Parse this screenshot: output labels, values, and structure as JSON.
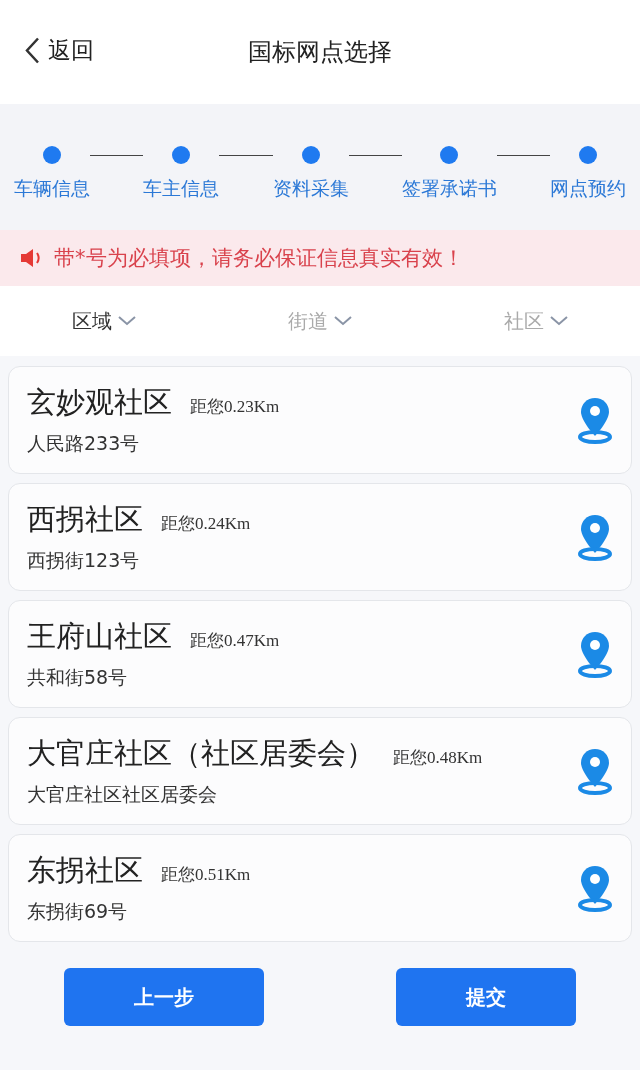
{
  "header": {
    "back": "返回",
    "title": "国标网点选择"
  },
  "steps": [
    {
      "label": "车辆信息",
      "done": true
    },
    {
      "label": "车主信息",
      "done": true
    },
    {
      "label": "资料采集",
      "done": true
    },
    {
      "label": "签署承诺书",
      "done": true
    },
    {
      "label": "网点预约",
      "done": true
    }
  ],
  "notice": "带*号为必填项，请务必保证信息真实有效！",
  "filters": [
    {
      "label": "区域",
      "selected": true
    },
    {
      "label": "街道",
      "selected": false
    },
    {
      "label": "社区",
      "selected": false
    }
  ],
  "sites": [
    {
      "name": "玄妙观社区",
      "distance": "距您0.23Km",
      "address": "人民路233号"
    },
    {
      "name": "西拐社区",
      "distance": "距您0.24Km",
      "address": "西拐街123号"
    },
    {
      "name": "王府山社区",
      "distance": "距您0.47Km",
      "address": "共和街58号"
    },
    {
      "name": "大官庄社区（社区居委会）",
      "distance": "距您0.48Km",
      "address": "大官庄社区社区居委会"
    },
    {
      "name": "东拐社区",
      "distance": "距您0.51Km",
      "address": "东拐街69号"
    }
  ],
  "buttons": [
    {
      "label": "上一步"
    },
    {
      "label": "提交"
    }
  ]
}
